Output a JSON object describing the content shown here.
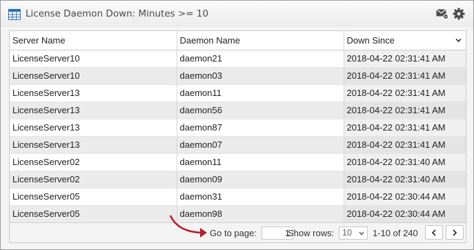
{
  "header": {
    "title": "License Daemon Down: Minutes >= 10",
    "icons": {
      "table": "table-icon",
      "mail": "mail-icon",
      "settings": "gear-icon"
    }
  },
  "table": {
    "columns": [
      "Server Name",
      "Daemon Name",
      "Down Since"
    ],
    "sorted_column": "Down Since",
    "rows": [
      [
        "LicenseServer10",
        "daemon21",
        "2018-04-22 02:31:41 AM"
      ],
      [
        "LicenseServer10",
        "daemon03",
        "2018-04-22 02:31:41 AM"
      ],
      [
        "LicenseServer13",
        "daemon11",
        "2018-04-22 02:31:41 AM"
      ],
      [
        "LicenseServer13",
        "daemon56",
        "2018-04-22 02:31:41 AM"
      ],
      [
        "LicenseServer13",
        "daemon87",
        "2018-04-22 02:31:41 AM"
      ],
      [
        "LicenseServer13",
        "daemon07",
        "2018-04-22 02:31:41 AM"
      ],
      [
        "LicenseServer02",
        "daemon11",
        "2018-04-22 02:31:40 AM"
      ],
      [
        "LicenseServer02",
        "daemon09",
        "2018-04-22 02:31:40 AM"
      ],
      [
        "LicenseServer05",
        "daemon31",
        "2018-04-22 02:30:44 AM"
      ],
      [
        "LicenseServer05",
        "daemon98",
        "2018-04-22 02:30:44 AM"
      ]
    ]
  },
  "pager": {
    "goto_label": "Go to page:",
    "page_value": "1",
    "show_rows_label": "Show rows:",
    "rows_value": "10",
    "range_text": "1-10 of 240"
  },
  "colors": {
    "accent_arrow": "#b3202a",
    "row_alt": "#ebebeb",
    "icon_blue": "#2a6fb5"
  }
}
